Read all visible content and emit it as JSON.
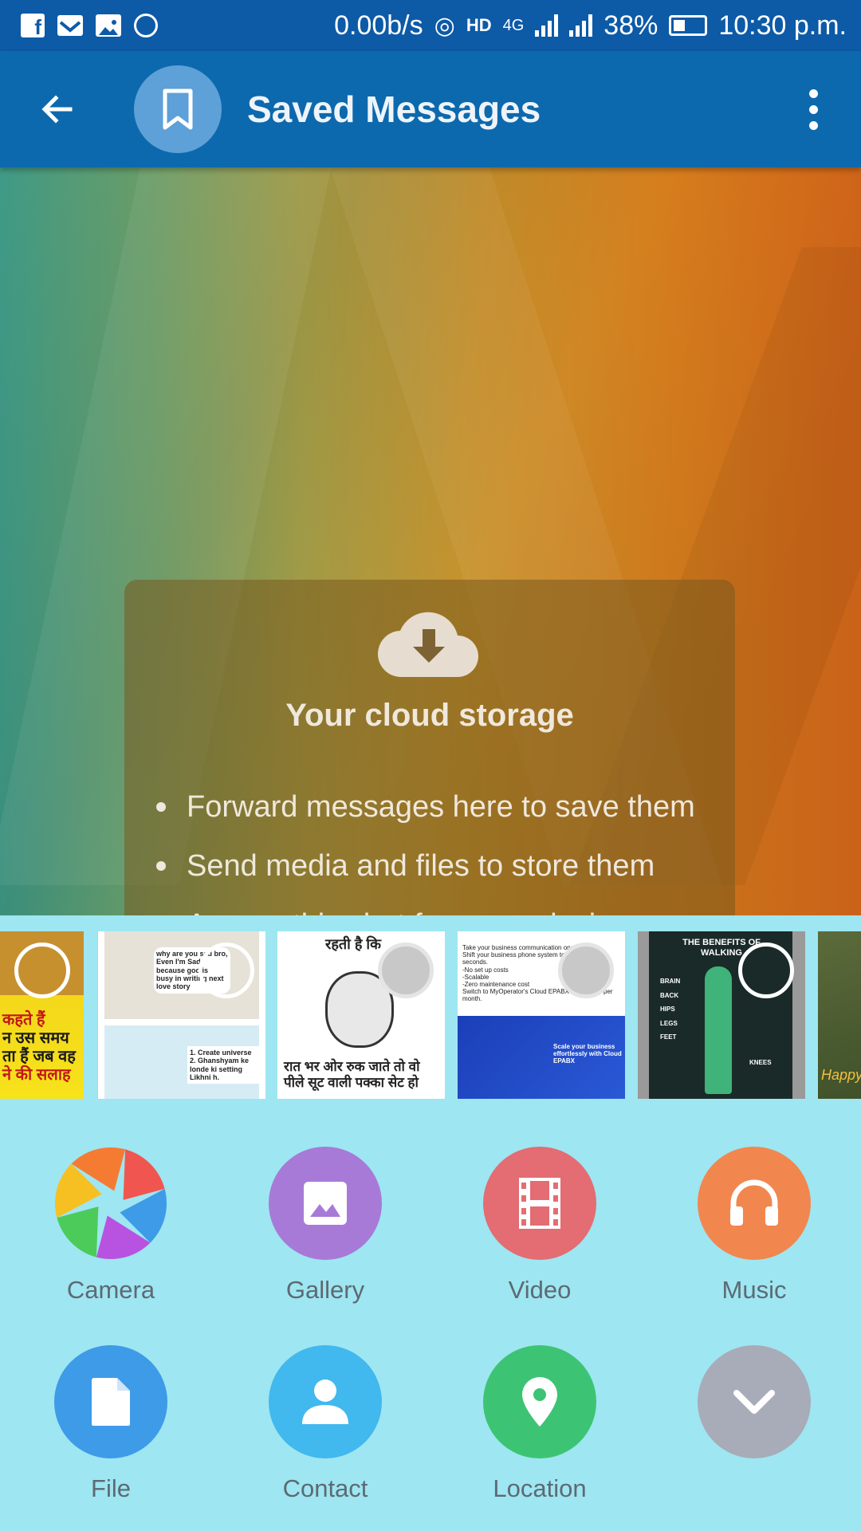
{
  "status_bar": {
    "speed": "0.00b/s",
    "network": "4G",
    "battery": "38%",
    "time": "10:30 p.m."
  },
  "app_bar": {
    "title": "Saved Messages",
    "avatar_icon": "bookmark-icon"
  },
  "cloud_card": {
    "title": "Your cloud storage",
    "items": [
      "Forward messages here to save them",
      "Send media and files to store them",
      "Access this chat from any device"
    ]
  },
  "gallery_thumbs": [
    {
      "caption_lines": [
        "कहते हैं",
        "न उस समय",
        "ता हैं जब वह",
        "ने की सलाह"
      ]
    },
    {
      "caption_lines": [
        "why are you sad bro,",
        "Even I'm Sad because god is",
        "busy in writing next love story",
        "1. Create universe",
        "2. Ghanshyam ke londe ki setting Likhni h."
      ]
    },
    {
      "caption_lines": [
        "रहती है कि",
        "रात भर ओर रुक जाते तो वो",
        "पीले सूट वाली पक्का सेट हो"
      ]
    },
    {
      "caption_lines": [
        "Take your business communication one notch up",
        "Shift your business phone system to cloud in just seconds.",
        "-No set up costs",
        "-Scalable",
        "-Zero maintenance cost",
        "Switch to MyOperator's Cloud EPABX at Rs.1500 per month.",
        "Scale your business effortlessly with Cloud EPABX"
      ]
    },
    {
      "caption_lines": [
        "THE BENEFITS OF WALKING",
        "BRAIN",
        "BACK",
        "HIPS",
        "LEGS",
        "KNEES",
        "FEET"
      ]
    },
    {
      "caption_lines": [
        "Happy"
      ]
    }
  ],
  "attach_options": [
    {
      "label": "Camera",
      "icon": "camera-aperture-icon",
      "color": "multicolor"
    },
    {
      "label": "Gallery",
      "icon": "image-icon",
      "color": "#a77ad8"
    },
    {
      "label": "Video",
      "icon": "film-icon",
      "color": "#e46c73"
    },
    {
      "label": "Music",
      "icon": "headphones-icon",
      "color": "#f2864f"
    },
    {
      "label": "File",
      "icon": "file-icon",
      "color": "#3d9be8"
    },
    {
      "label": "Contact",
      "icon": "person-icon",
      "color": "#41b8ee"
    },
    {
      "label": "Location",
      "icon": "location-pin-icon",
      "color": "#3cc474"
    },
    {
      "label": "",
      "icon": "chevron-down-icon",
      "color": "#a8acb8"
    }
  ]
}
